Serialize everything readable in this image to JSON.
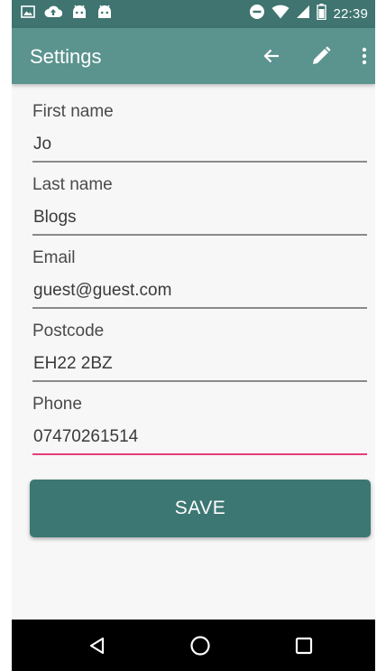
{
  "status_bar": {
    "time": "22:39",
    "left_icons": [
      "image-icon",
      "cloud-upload-icon",
      "android-icon",
      "android-icon"
    ],
    "right_icons": [
      "do-not-disturb-icon",
      "wifi-icon",
      "signal-icon",
      "battery-icon"
    ]
  },
  "app_bar": {
    "title": "Settings",
    "actions": [
      "arrow-back-icon",
      "edit-pencil-icon",
      "more-vert-icon"
    ]
  },
  "form": {
    "fields": [
      {
        "label": "First name",
        "value": "Jo"
      },
      {
        "label": "Last name",
        "value": "Blogs"
      },
      {
        "label": "Email",
        "value": "guest@guest.com"
      },
      {
        "label": "Postcode",
        "value": "EH22 2BZ"
      },
      {
        "label": "Phone",
        "value": "07470261514"
      }
    ],
    "save_label": "SAVE"
  },
  "nav_bar": {
    "buttons": [
      "back-triangle-icon",
      "home-circle-icon",
      "recents-square-icon"
    ]
  },
  "colors": {
    "status_bar": "#3f7470",
    "app_bar": "#5b938e",
    "button": "#3d7773",
    "focus_accent": "#e63e7a"
  }
}
